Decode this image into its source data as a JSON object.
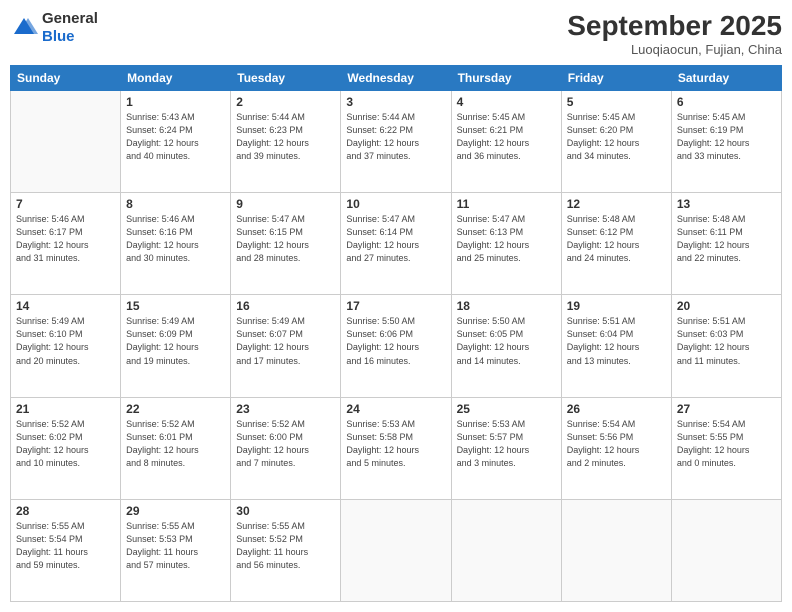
{
  "header": {
    "logo_general": "General",
    "logo_blue": "Blue",
    "month_title": "September 2025",
    "location": "Luoqiaocun, Fujian, China"
  },
  "weekdays": [
    "Sunday",
    "Monday",
    "Tuesday",
    "Wednesday",
    "Thursday",
    "Friday",
    "Saturday"
  ],
  "weeks": [
    [
      {
        "day": "",
        "info": ""
      },
      {
        "day": "1",
        "info": "Sunrise: 5:43 AM\nSunset: 6:24 PM\nDaylight: 12 hours\nand 40 minutes."
      },
      {
        "day": "2",
        "info": "Sunrise: 5:44 AM\nSunset: 6:23 PM\nDaylight: 12 hours\nand 39 minutes."
      },
      {
        "day": "3",
        "info": "Sunrise: 5:44 AM\nSunset: 6:22 PM\nDaylight: 12 hours\nand 37 minutes."
      },
      {
        "day": "4",
        "info": "Sunrise: 5:45 AM\nSunset: 6:21 PM\nDaylight: 12 hours\nand 36 minutes."
      },
      {
        "day": "5",
        "info": "Sunrise: 5:45 AM\nSunset: 6:20 PM\nDaylight: 12 hours\nand 34 minutes."
      },
      {
        "day": "6",
        "info": "Sunrise: 5:45 AM\nSunset: 6:19 PM\nDaylight: 12 hours\nand 33 minutes."
      }
    ],
    [
      {
        "day": "7",
        "info": "Sunrise: 5:46 AM\nSunset: 6:17 PM\nDaylight: 12 hours\nand 31 minutes."
      },
      {
        "day": "8",
        "info": "Sunrise: 5:46 AM\nSunset: 6:16 PM\nDaylight: 12 hours\nand 30 minutes."
      },
      {
        "day": "9",
        "info": "Sunrise: 5:47 AM\nSunset: 6:15 PM\nDaylight: 12 hours\nand 28 minutes."
      },
      {
        "day": "10",
        "info": "Sunrise: 5:47 AM\nSunset: 6:14 PM\nDaylight: 12 hours\nand 27 minutes."
      },
      {
        "day": "11",
        "info": "Sunrise: 5:47 AM\nSunset: 6:13 PM\nDaylight: 12 hours\nand 25 minutes."
      },
      {
        "day": "12",
        "info": "Sunrise: 5:48 AM\nSunset: 6:12 PM\nDaylight: 12 hours\nand 24 minutes."
      },
      {
        "day": "13",
        "info": "Sunrise: 5:48 AM\nSunset: 6:11 PM\nDaylight: 12 hours\nand 22 minutes."
      }
    ],
    [
      {
        "day": "14",
        "info": "Sunrise: 5:49 AM\nSunset: 6:10 PM\nDaylight: 12 hours\nand 20 minutes."
      },
      {
        "day": "15",
        "info": "Sunrise: 5:49 AM\nSunset: 6:09 PM\nDaylight: 12 hours\nand 19 minutes."
      },
      {
        "day": "16",
        "info": "Sunrise: 5:49 AM\nSunset: 6:07 PM\nDaylight: 12 hours\nand 17 minutes."
      },
      {
        "day": "17",
        "info": "Sunrise: 5:50 AM\nSunset: 6:06 PM\nDaylight: 12 hours\nand 16 minutes."
      },
      {
        "day": "18",
        "info": "Sunrise: 5:50 AM\nSunset: 6:05 PM\nDaylight: 12 hours\nand 14 minutes."
      },
      {
        "day": "19",
        "info": "Sunrise: 5:51 AM\nSunset: 6:04 PM\nDaylight: 12 hours\nand 13 minutes."
      },
      {
        "day": "20",
        "info": "Sunrise: 5:51 AM\nSunset: 6:03 PM\nDaylight: 12 hours\nand 11 minutes."
      }
    ],
    [
      {
        "day": "21",
        "info": "Sunrise: 5:52 AM\nSunset: 6:02 PM\nDaylight: 12 hours\nand 10 minutes."
      },
      {
        "day": "22",
        "info": "Sunrise: 5:52 AM\nSunset: 6:01 PM\nDaylight: 12 hours\nand 8 minutes."
      },
      {
        "day": "23",
        "info": "Sunrise: 5:52 AM\nSunset: 6:00 PM\nDaylight: 12 hours\nand 7 minutes."
      },
      {
        "day": "24",
        "info": "Sunrise: 5:53 AM\nSunset: 5:58 PM\nDaylight: 12 hours\nand 5 minutes."
      },
      {
        "day": "25",
        "info": "Sunrise: 5:53 AM\nSunset: 5:57 PM\nDaylight: 12 hours\nand 3 minutes."
      },
      {
        "day": "26",
        "info": "Sunrise: 5:54 AM\nSunset: 5:56 PM\nDaylight: 12 hours\nand 2 minutes."
      },
      {
        "day": "27",
        "info": "Sunrise: 5:54 AM\nSunset: 5:55 PM\nDaylight: 12 hours\nand 0 minutes."
      }
    ],
    [
      {
        "day": "28",
        "info": "Sunrise: 5:55 AM\nSunset: 5:54 PM\nDaylight: 11 hours\nand 59 minutes."
      },
      {
        "day": "29",
        "info": "Sunrise: 5:55 AM\nSunset: 5:53 PM\nDaylight: 11 hours\nand 57 minutes."
      },
      {
        "day": "30",
        "info": "Sunrise: 5:55 AM\nSunset: 5:52 PM\nDaylight: 11 hours\nand 56 minutes."
      },
      {
        "day": "",
        "info": ""
      },
      {
        "day": "",
        "info": ""
      },
      {
        "day": "",
        "info": ""
      },
      {
        "day": "",
        "info": ""
      }
    ]
  ]
}
